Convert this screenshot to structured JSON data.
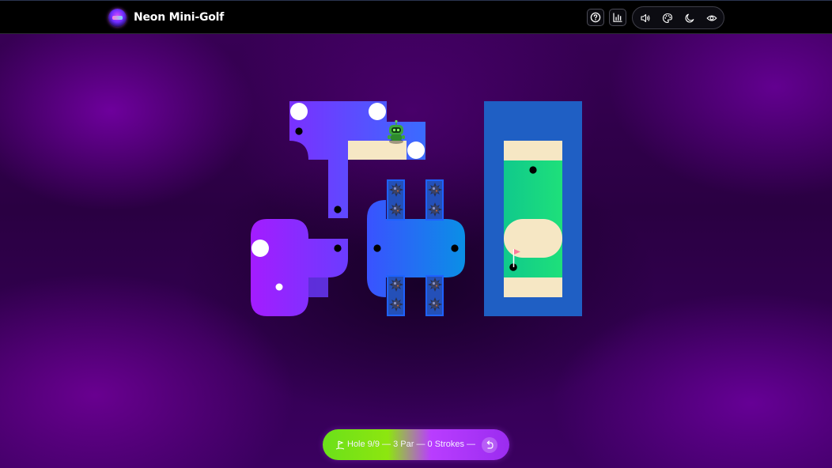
{
  "header": {
    "app_title": "Neon Mini-Golf",
    "logo_icon": "neon-golf-logo",
    "buttons": [
      {
        "name": "help-button",
        "icon": "question-circle-icon"
      },
      {
        "name": "stats-button",
        "icon": "bar-chart-icon"
      }
    ],
    "toggle_group": [
      {
        "name": "sound-toggle",
        "icon": "speaker-icon"
      },
      {
        "name": "theme-toggle",
        "icon": "palette-icon"
      },
      {
        "name": "dark-mode-toggle",
        "icon": "moon-icon"
      },
      {
        "name": "visibility-toggle",
        "icon": "eye-icon"
      }
    ]
  },
  "course": {
    "colors": {
      "purple_green": "#7b3bff",
      "blue_green": "#1a7fe8",
      "sand": "#f6e7c4",
      "water_border": "#1f5fc4",
      "fairway": "#14d98a",
      "hole": "#000000",
      "flag": "#ff7a9a"
    },
    "player_icon": "green-robot-icon",
    "hazard_icon": "spiky-mine-icon",
    "flag_icon": "pink-flag-icon"
  },
  "status": {
    "hole_icon": "golf-flag-icon",
    "hole_label": "Hole 9/9",
    "separator1": " — ",
    "par_label": "3 Par",
    "separator2": " — ",
    "strokes_label": "0 Strokes",
    "separator3": " — ",
    "undo_icon": "undo-icon"
  }
}
